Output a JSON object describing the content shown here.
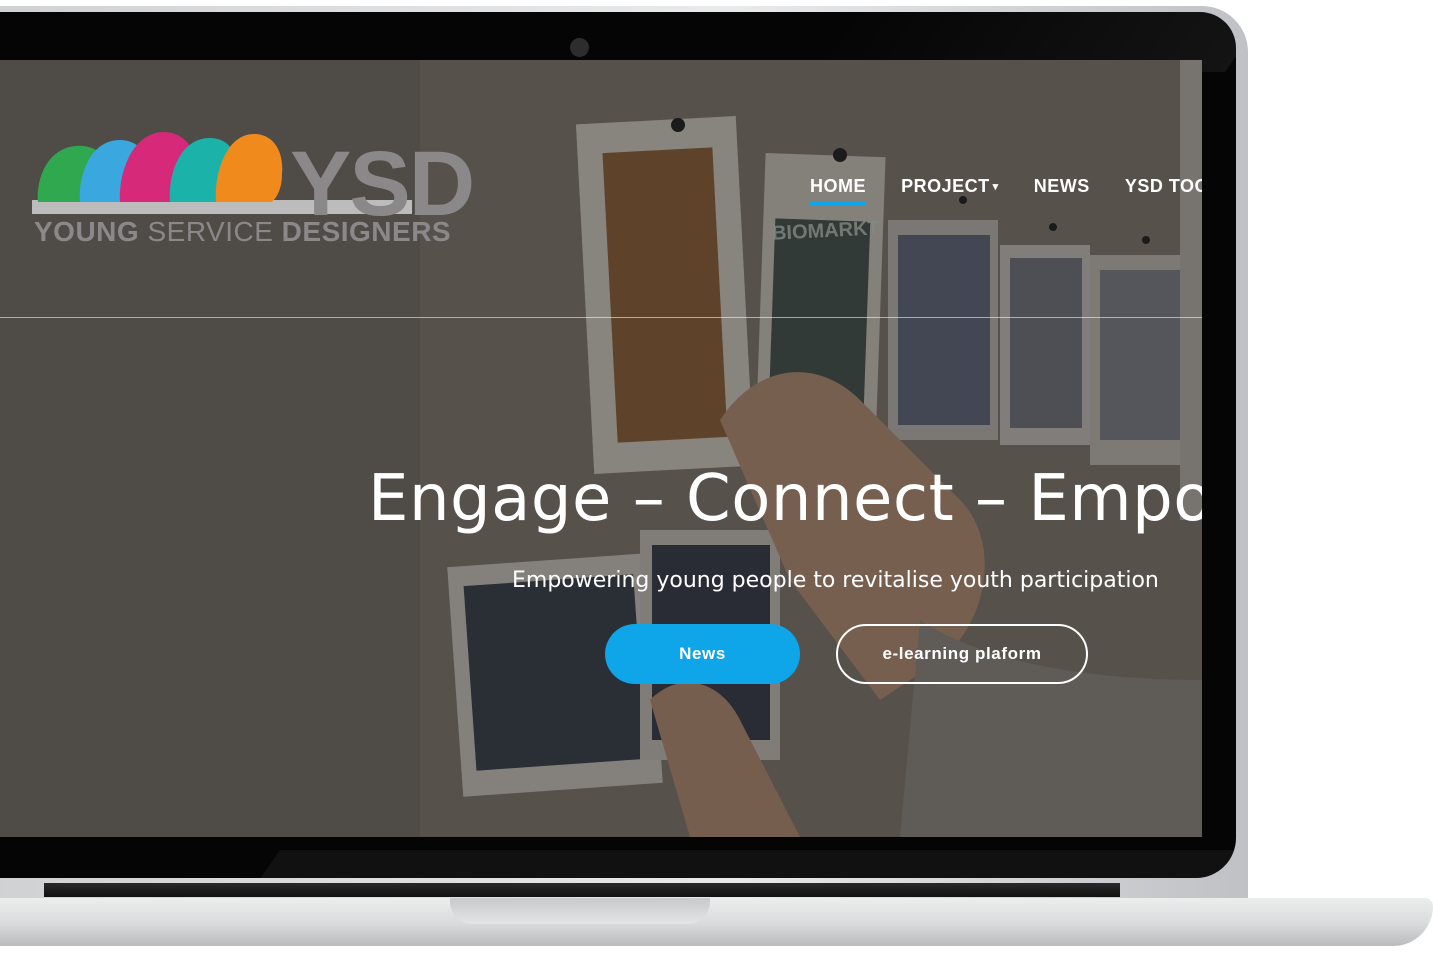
{
  "logo": {
    "abbr": "YSD",
    "word_young": "YOUNG",
    "word_service": "SERVICE",
    "word_designers": "DESIGNERS",
    "head_colors": [
      "#2fa84f",
      "#3aa7de",
      "#d6297a",
      "#1bb3a9",
      "#f08a1c"
    ]
  },
  "nav": {
    "items": [
      {
        "label": "HOME",
        "active": true
      },
      {
        "label": "PROJECT",
        "dropdown": true
      },
      {
        "label": "NEWS"
      },
      {
        "label": "YSD TOO"
      }
    ],
    "caret": "▾"
  },
  "hero": {
    "title": "Engage – Connect – Empo",
    "subtitle": "Empowering young people to revitalise youth participation",
    "buttons": {
      "news": "News",
      "elearning": "e-learning plaform"
    }
  },
  "background_photo": {
    "sign_text": "BIOMARKT"
  },
  "colors": {
    "accent": "#0ea5e9",
    "logo_gray": "#8a8888"
  }
}
